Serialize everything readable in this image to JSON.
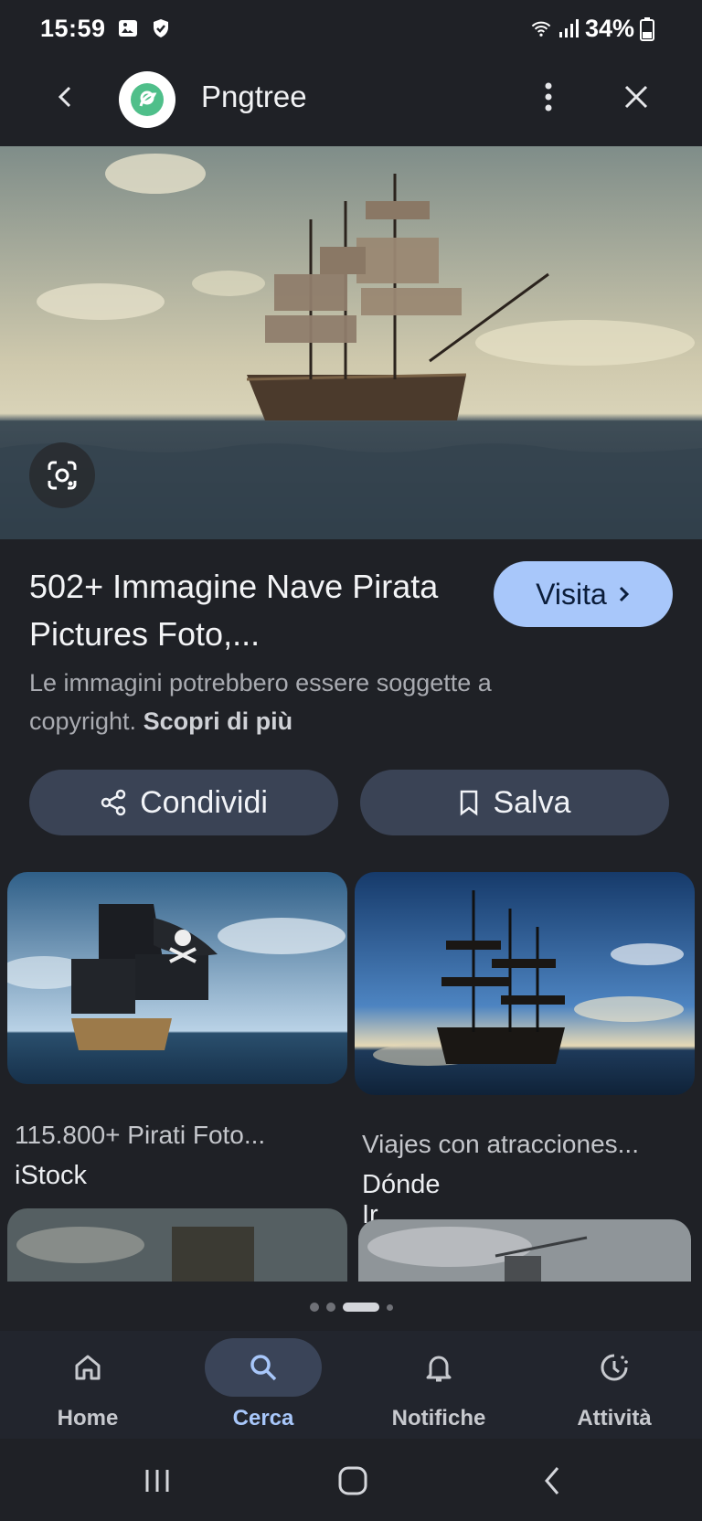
{
  "status_bar": {
    "time": "15:59",
    "battery": "34%",
    "icons": [
      "gallery-icon",
      "shield-icon",
      "wifi-icon",
      "signal-icon",
      "battery-icon"
    ]
  },
  "app_bar": {
    "site_name": "Pngtree",
    "icons": [
      "back-arrow-icon",
      "pngtree-logo",
      "more-vert-icon",
      "close-icon"
    ]
  },
  "result": {
    "title": "502+ Immagine Nave Pirata Pictures Foto,...",
    "visit_label": "Visita",
    "copyright_text": "Le immagini potrebbero essere soggette a copyright.",
    "learn_more": "Scopri di più"
  },
  "actions": {
    "share_label": "Condividi",
    "save_label": "Salva"
  },
  "related": [
    {
      "caption": "115.800+ Pirati Foto...",
      "source": "iStock"
    },
    {
      "caption": "Viajes con atracciones...",
      "source": "Dónde Ir"
    }
  ],
  "bottom_nav": {
    "items": [
      {
        "label": "Home",
        "icon": "home-icon"
      },
      {
        "label": "Cerca",
        "icon": "search-icon",
        "active": true
      },
      {
        "label": "Notifiche",
        "icon": "bell-icon"
      },
      {
        "label": "Attività",
        "icon": "activity-icon"
      }
    ]
  },
  "colors": {
    "background": "#1f2126",
    "accent": "#a8c7fa",
    "chip": "#3a4355"
  }
}
